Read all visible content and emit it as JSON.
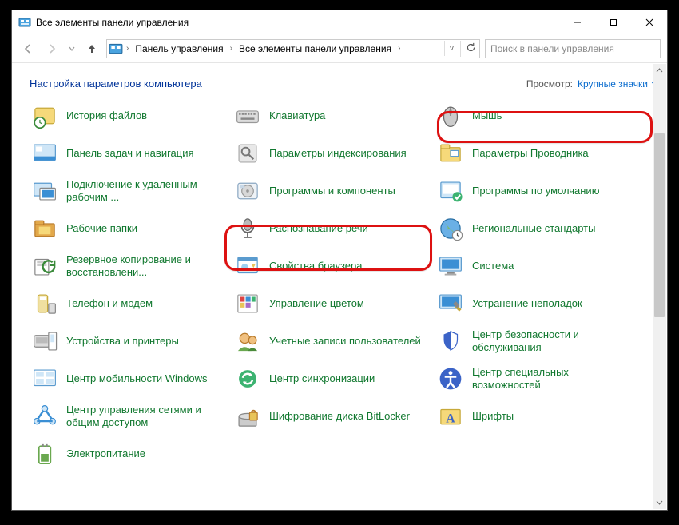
{
  "window": {
    "title": "Все элементы панели управления"
  },
  "nav": {
    "crumb1": "Панель управления",
    "crumb2": "Все элементы панели управления",
    "search_placeholder": "Поиск в панели управления"
  },
  "header": {
    "title": "Настройка параметров компьютера",
    "view_label": "Просмотр:",
    "view_value": "Крупные значки"
  },
  "items": [
    {
      "label": "История файлов",
      "icon": "history"
    },
    {
      "label": "Клавиатура",
      "icon": "keyboard"
    },
    {
      "label": "Мышь",
      "icon": "mouse"
    },
    {
      "label": "Панель задач и навигация",
      "icon": "taskbar"
    },
    {
      "label": "Параметры индексирования",
      "icon": "index"
    },
    {
      "label": "Параметры Проводника",
      "icon": "explorer"
    },
    {
      "label": "Подключение к удаленным рабочим ...",
      "icon": "remote"
    },
    {
      "label": "Программы и компоненты",
      "icon": "programs"
    },
    {
      "label": "Программы по умолчанию",
      "icon": "defaults"
    },
    {
      "label": "Рабочие папки",
      "icon": "workfolders"
    },
    {
      "label": "Распознавание речи",
      "icon": "speech"
    },
    {
      "label": "Региональные стандарты",
      "icon": "region"
    },
    {
      "label": "Резервное копирование и восстановлени...",
      "icon": "backup"
    },
    {
      "label": "Свойства браузера",
      "icon": "browser"
    },
    {
      "label": "Система",
      "icon": "system"
    },
    {
      "label": "Телефон и модем",
      "icon": "phone"
    },
    {
      "label": "Управление цветом",
      "icon": "color"
    },
    {
      "label": "Устранение неполадок",
      "icon": "trouble"
    },
    {
      "label": "Устройства и принтеры",
      "icon": "devices"
    },
    {
      "label": "Учетные записи пользователей",
      "icon": "users"
    },
    {
      "label": "Центр безопасности и обслуживания",
      "icon": "security"
    },
    {
      "label": "Центр мобильности Windows",
      "icon": "mobility"
    },
    {
      "label": "Центр синхронизации",
      "icon": "sync"
    },
    {
      "label": "Центр специальных возможностей",
      "icon": "ease"
    },
    {
      "label": "Центр управления сетями и общим доступом",
      "icon": "network"
    },
    {
      "label": "Шифрование диска BitLocker",
      "icon": "bitlocker"
    },
    {
      "label": "Шрифты",
      "icon": "fonts"
    },
    {
      "label": "Электропитание",
      "icon": "power"
    }
  ],
  "colors": {
    "link": "#11782f",
    "accent": "#0a6cce",
    "callout": "#d11"
  }
}
